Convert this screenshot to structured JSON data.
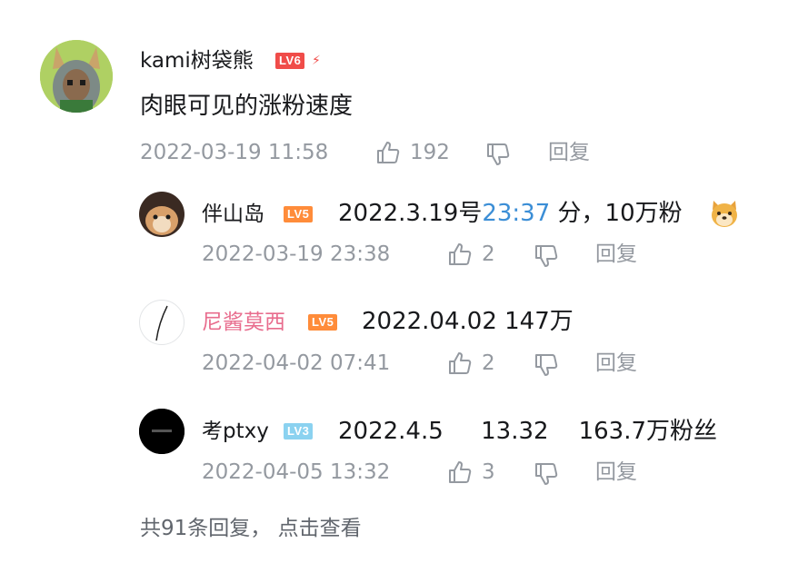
{
  "main_comment": {
    "username": "kami树袋熊",
    "level": "LV6",
    "content": "肉眼可见的涨粉速度",
    "timestamp": "2022-03-19 11:58",
    "likes": "192",
    "reply_label": "回复"
  },
  "replies": [
    {
      "username": "伴山岛",
      "level": "LV5",
      "content_prefix": "2022.3.19号",
      "content_link": "23:37",
      "content_suffix": " 分，10万粉",
      "timestamp": "2022-03-19 23:38",
      "likes": "2",
      "reply_label": "回复"
    },
    {
      "username": "尼酱莫西",
      "level": "LV5",
      "content": "2022.04.02 147万",
      "timestamp": "2022-04-02 07:41",
      "likes": "2",
      "reply_label": "回复"
    },
    {
      "username": "考ptxy",
      "level": "LV3",
      "content": "2022.4.5     13.32    163.7万粉丝",
      "timestamp": "2022-04-05 13:32",
      "likes": "3",
      "reply_label": "回复"
    }
  ],
  "footer": {
    "more_replies": "共91条回复，  点击查看"
  },
  "colors": {
    "lv6": "#f04c49",
    "lv5": "#ff8c3a",
    "lv3": "#8bd2f0",
    "vip_name": "#e86c8d",
    "link": "#3b8ed6",
    "meta": "#9499a0"
  }
}
